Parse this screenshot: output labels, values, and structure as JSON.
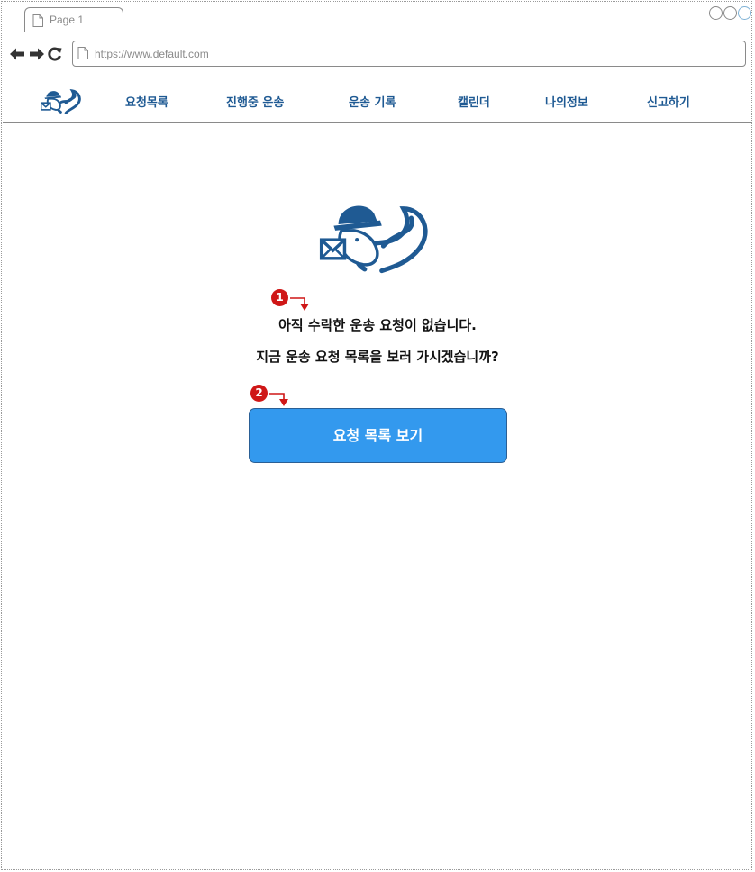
{
  "browser": {
    "tab_title": "Page 1",
    "url": "https://www.default.com"
  },
  "header": {
    "logo_icon": "squirrel-mail-logo",
    "menu": [
      {
        "label": "요청목록"
      },
      {
        "label": "진행중 운송"
      },
      {
        "label": "운송 기록"
      },
      {
        "label": "캘린더"
      },
      {
        "label": "나의정보"
      },
      {
        "label": "신고하기"
      }
    ]
  },
  "main": {
    "logo_icon": "squirrel-mail-logo",
    "message_line1": "아직 수락한 운송 요청이 없습니다.",
    "message_line2": "지금 운송 요청 목록을 보러 가시겠습니까?",
    "cta_label": "요청 목록 보기"
  },
  "annotations": [
    "1",
    "2"
  ],
  "colors": {
    "primary_button": "#3399ee",
    "menu_text": "#1f5a93",
    "annotation": "#cf1717",
    "logo": "#1f5a93"
  }
}
